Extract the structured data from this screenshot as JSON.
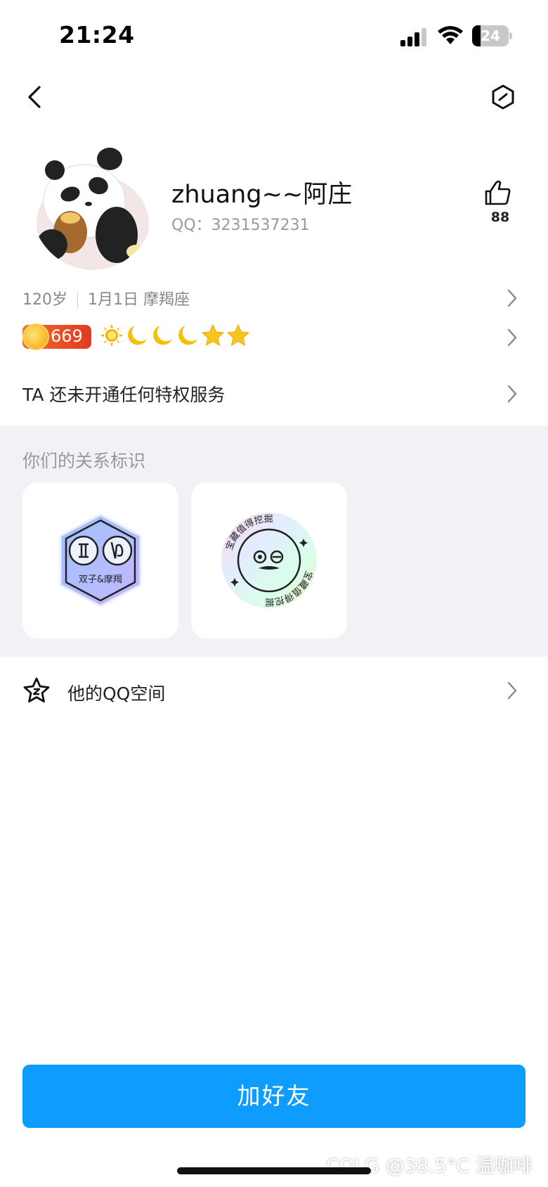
{
  "status_bar": {
    "time": "21:24",
    "battery_level": "24",
    "battery_fraction": 0.24
  },
  "profile": {
    "nickname": "zhuang~~阿庄",
    "qq_label": "QQ：3231537231",
    "like_count": "88"
  },
  "info": {
    "age": "120岁",
    "birthday": "1月1日",
    "zodiac": "摩羯座"
  },
  "level": {
    "value": "669",
    "icons": [
      "sun-icon",
      "moon-icon",
      "moon-icon",
      "moon-icon",
      "star-icon",
      "star-icon"
    ]
  },
  "privilege": {
    "text": "TA 还未开通任何特权服务"
  },
  "relation": {
    "title": "你们的关系标识",
    "badges": [
      {
        "name": "zodiac-pair-badge",
        "label": "双子&摩羯"
      },
      {
        "name": "treasure-dig-badge",
        "ring_text": "宝藏值得挖掘"
      }
    ]
  },
  "qzone": {
    "label": "他的QQ空间"
  },
  "actions": {
    "add_friend": "加好友"
  },
  "watermark": "COLG @38.5°C 温咖啡",
  "colors": {
    "accent": "#0e9cff",
    "level_badge": "#e6461f",
    "section_bg": "#f2f2f6"
  }
}
